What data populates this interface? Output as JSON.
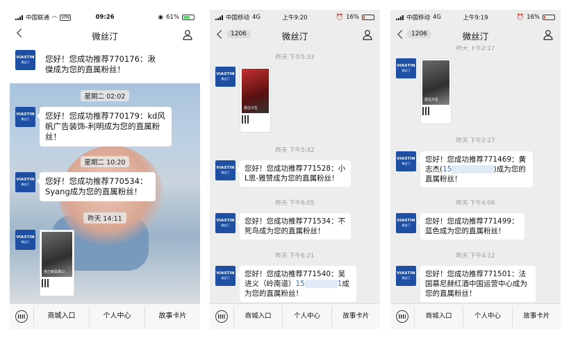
{
  "colors": {
    "avatar_bg": "#1f4fa3",
    "link": "#3c6fb4",
    "battery_green": "#4cd964",
    "battery_red": "#ff3b30"
  },
  "phones": [
    {
      "status": {
        "carrier": "中国联通",
        "vpn": "VPN",
        "time": "09:26",
        "battery": "61%"
      },
      "title": "微丝汀",
      "back_label": "",
      "messages": [
        {
          "text": "您好！您成功推荐770176：湫傑成为您的直属粉丝！"
        },
        {
          "time": "星期二 02:02"
        },
        {
          "text": "您好！您成功推荐770179：kd风帆广告装饰-利明成为您的直属粉丝！"
        },
        {
          "time": "星期二 10:20"
        },
        {
          "text": "您好！您成功推荐770534：Syang成为您的直属粉丝！"
        },
        {
          "time": "昨天 14:11"
        },
        {
          "card": "自己就是靠山"
        }
      ],
      "tabs": [
        "商城入口",
        "个人中心",
        "故事卡片"
      ]
    },
    {
      "status": {
        "carrier": "中国移动",
        "network": "4G",
        "time": "上午9:20",
        "battery": "16%"
      },
      "title": "微丝汀",
      "back_label": "1206",
      "messages": [
        {
          "time": "昨天 下午5:33"
        },
        {
          "card": "逐过众生"
        },
        {
          "time": "昨天 下午5:42"
        },
        {
          "text": "您好！您成功推荐771528：小L思-雅赞成为您的直属粉丝！"
        },
        {
          "time": "昨天 下午6:05"
        },
        {
          "text": "您好！您成功推荐771534：不死鸟成为您的直属粉丝！"
        },
        {
          "time": "昨天 下午6:21"
        },
        {
          "text_a": "您好！您成功推荐771540：吴进义（岭南道）",
          "link_a": "15",
          "link_b": "1",
          "text_b": "成为您的直属粉丝！"
        }
      ],
      "tabs": [
        "商城入口",
        "个人中心",
        "故事卡片"
      ]
    },
    {
      "status": {
        "carrier": "中国移动",
        "network": "4G",
        "time": "上午9:19",
        "battery": "16%"
      },
      "title": "微丝汀",
      "back_label": "1206",
      "messages": [
        {
          "time": "昨天 下午2:17"
        },
        {
          "card": "逐过众生"
        },
        {
          "time": "昨天 下午2:27"
        },
        {
          "text_a": "您好！您成功推荐771469：黄志杰(",
          "link_a": "15",
          "link_b": "",
          "text_b": ")成为您的直属粉丝！"
        },
        {
          "time": "昨天 下午4:06"
        },
        {
          "text": "您好！您成功推荐771499：蓝色成为您的直属粉丝！"
        },
        {
          "time": "昨天 下午4:12"
        },
        {
          "text": "您好！您成功推荐771501：法国慕尼赫红酒中国运营中心成为您的直属粉丝！"
        }
      ],
      "tabs": [
        "商城入口",
        "个人中心",
        "故事卡片"
      ]
    }
  ],
  "avatar": {
    "brand": "VIASTIN",
    "sub": "微丝汀"
  }
}
